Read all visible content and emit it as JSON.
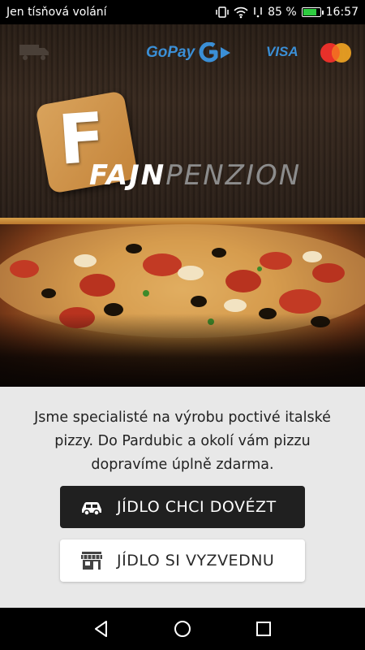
{
  "status_bar": {
    "carrier_text": "Jen tísňová volání",
    "battery_percent": "85 %",
    "battery_level": 0.85,
    "time": "16:57"
  },
  "header": {
    "payment_gopay": "GoPay",
    "payment_visa": "VISA",
    "brand_letter": "F",
    "brand_name_part1": "FAJN",
    "brand_name_part2": "PENZION"
  },
  "panel": {
    "intro_text": "Jsme specialisté na výrobu poctivé italské pizzy. Do Pardubic a okolí vám pizzu dopravíme úplně zdarma.",
    "delivery_button_label": "JÍDLO CHCI DOVÉZT",
    "pickup_button_label": "JÍDLO SI VYZVEDNU"
  },
  "icons": {
    "truck": "delivery-truck-icon",
    "car": "car-icon",
    "store": "store-icon"
  },
  "colors": {
    "accent_gold": "#c4843a",
    "gopay_blue": "#3b8fd6",
    "button_dark": "#202020"
  }
}
